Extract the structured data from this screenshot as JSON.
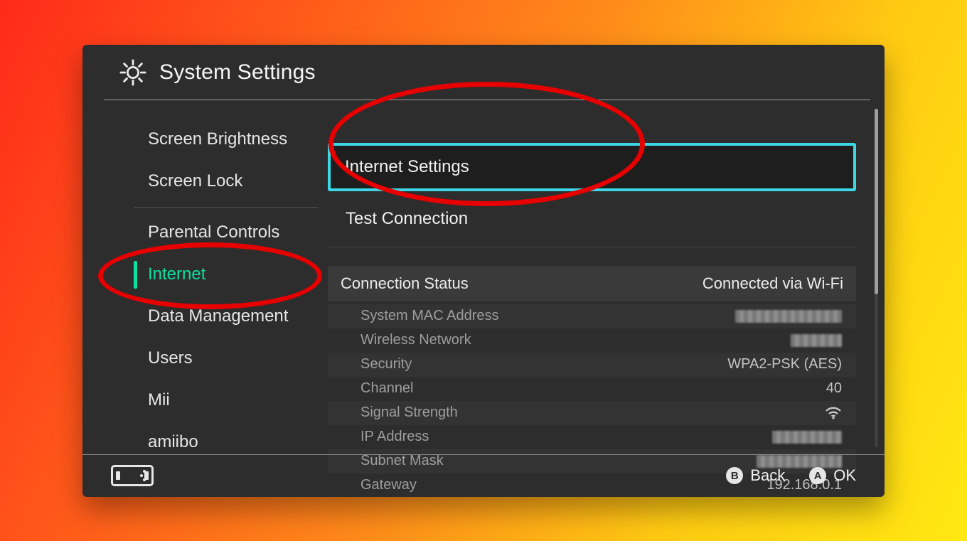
{
  "header": {
    "title": "System Settings"
  },
  "sidebar": {
    "items": [
      "Screen Brightness",
      "Screen Lock",
      "Parental Controls",
      "Internet",
      "Data Management",
      "Users",
      "Mii",
      "amiibo"
    ],
    "activeIndex": 3
  },
  "content": {
    "options": [
      "Internet Settings",
      "Test Connection"
    ],
    "status": {
      "label": "Connection Status",
      "value": "Connected via Wi-Fi"
    },
    "details": [
      {
        "label": "System MAC Address",
        "value": "",
        "redacted": true
      },
      {
        "label": "Wireless Network",
        "value": "",
        "redacted": true
      },
      {
        "label": "Security",
        "value": "WPA2-PSK (AES)"
      },
      {
        "label": "Channel",
        "value": "40"
      },
      {
        "label": "Signal Strength",
        "value": "wifi-icon"
      },
      {
        "label": "IP Address",
        "value": "",
        "redacted": true
      },
      {
        "label": "Subnet Mask",
        "value": "",
        "redacted": true
      },
      {
        "label": "Gateway",
        "value": "192.168.0.1"
      }
    ]
  },
  "footer": {
    "back": "Back",
    "ok": "OK",
    "backBtn": "B",
    "okBtn": "A"
  }
}
